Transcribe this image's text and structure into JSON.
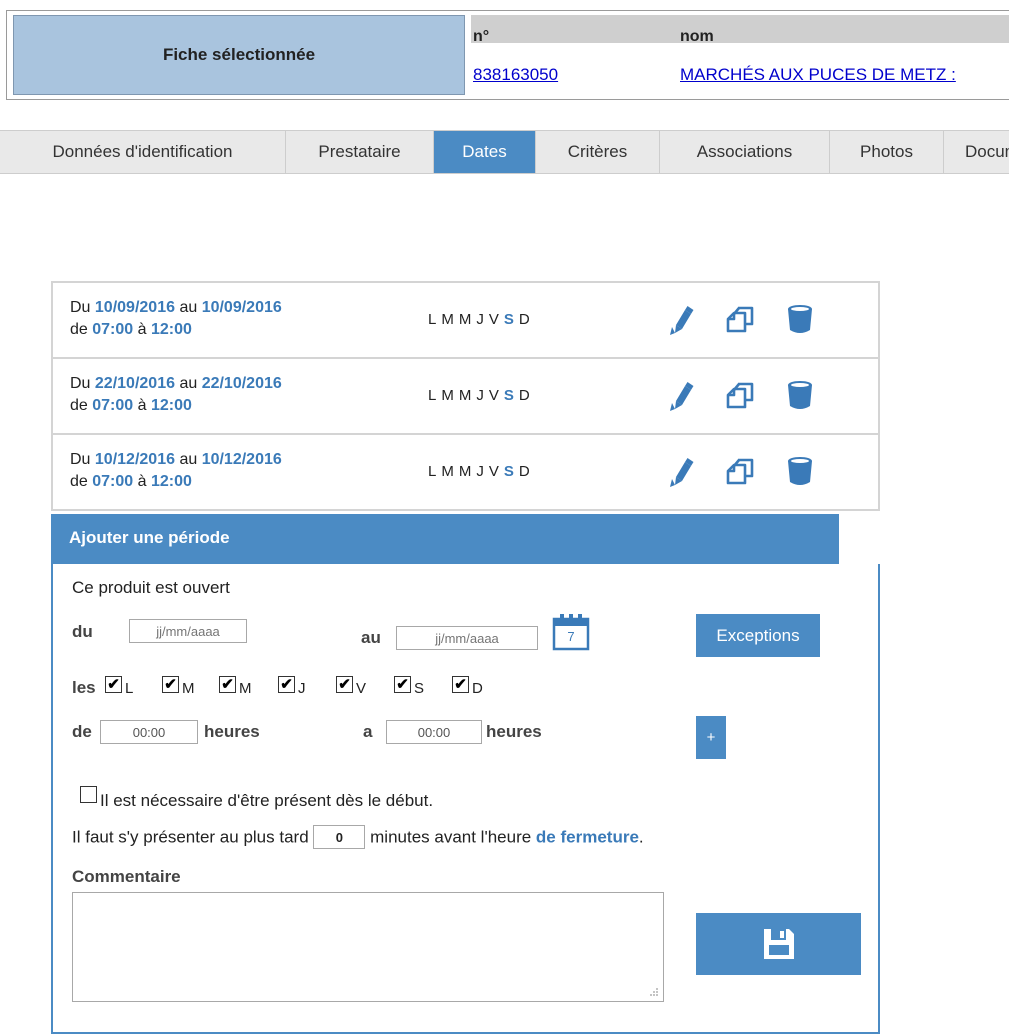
{
  "fiche": {
    "label": "Fiche sélectionnée",
    "col_num": "n°",
    "col_nom": "nom",
    "num": "838163050",
    "nom": "MARCHÉS AUX PUCES DE METZ :"
  },
  "tabs": [
    {
      "label": "Données d'identification",
      "active": false
    },
    {
      "label": "Prestataire",
      "active": false
    },
    {
      "label": "Dates",
      "active": true
    },
    {
      "label": "Critères",
      "active": false
    },
    {
      "label": "Associations",
      "active": false
    },
    {
      "label": "Photos",
      "active": false
    },
    {
      "label": "Documents",
      "active": false
    }
  ],
  "periods": {
    "du": "Du",
    "au": "au",
    "de": "de",
    "a": "à",
    "days": [
      "L",
      "M",
      "M",
      "J",
      "V",
      "S",
      "D"
    ],
    "active_day_index": 5,
    "icons": [
      "pencil-icon",
      "copy-icon",
      "trash-icon"
    ],
    "items": [
      {
        "start_date": "10/09/2016",
        "end_date": "10/09/2016",
        "start_time": "07:00",
        "end_time": "12:00"
      },
      {
        "start_date": "22/10/2016",
        "end_date": "22/10/2016",
        "start_time": "07:00",
        "end_time": "12:00"
      },
      {
        "start_date": "10/12/2016",
        "end_date": "10/12/2016",
        "start_time": "07:00",
        "end_time": "12:00"
      }
    ]
  },
  "add": {
    "title": "Ajouter une période",
    "open_text": "Ce produit est ouvert",
    "du_label": "du",
    "au_label": "au",
    "date_placeholder": "jj/mm/aaaa",
    "calendar_day": "7",
    "exceptions_label": "Exceptions",
    "les_label": "les",
    "day_checks": [
      {
        "label": "L",
        "checked": true
      },
      {
        "label": "M",
        "checked": true
      },
      {
        "label": "M",
        "checked": true
      },
      {
        "label": "J",
        "checked": true
      },
      {
        "label": "V",
        "checked": true
      },
      {
        "label": "S",
        "checked": true
      },
      {
        "label": "D",
        "checked": true
      }
    ],
    "de_label": "de",
    "a_label": "a",
    "time_from": "00:00",
    "time_to": "00:00",
    "heures_label": "heures",
    "plus_label": "+",
    "present_label": "Il est nécessaire d'être présent dès le début.",
    "late_before": "Il faut s'y présenter au plus tard",
    "late_value": "0",
    "late_after": "minutes avant l'heure",
    "late_link": "de fermeture",
    "late_end": ".",
    "comment_label": "Commentaire",
    "comment_value": "",
    "save_icon": "floppy-disk-icon"
  },
  "colors": {
    "accent": "#4b8bc4",
    "highlight_text": "#3a7ab8",
    "header_bg": "#a9c4de",
    "link": "#0000cc"
  }
}
